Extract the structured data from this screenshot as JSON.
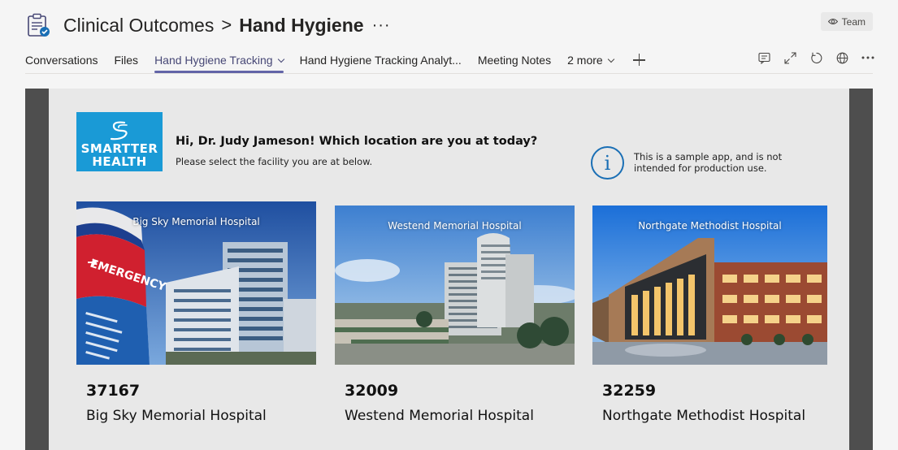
{
  "header": {
    "breadcrumb_parent": "Clinical Outcomes",
    "separator": ">",
    "current_channel": "Hand Hygiene",
    "more_label": "···",
    "team_badge": "Team"
  },
  "tabs": [
    {
      "label": "Conversations",
      "active": false
    },
    {
      "label": "Files",
      "active": false
    },
    {
      "label": "Hand Hygiene Tracking",
      "active": true
    },
    {
      "label": "Hand Hygiene Tracking Analyt...",
      "active": false
    },
    {
      "label": "Meeting Notes",
      "active": false
    },
    {
      "label": "2 more",
      "active": false
    }
  ],
  "toolbar": {
    "icons": [
      "chat-icon",
      "expand-icon",
      "refresh-icon",
      "globe-icon",
      "more-options-icon"
    ]
  },
  "app": {
    "logo_line1": "SMARTTER",
    "logo_line2": "HEALTH",
    "greeting": "Hi, Dr. Judy Jameson! Which location are you at today?",
    "subgreeting": "Please select the facility you are at below.",
    "info_symbol": "i",
    "info_text": "This is a sample app, and is not intended for production use.",
    "hospitals": [
      {
        "photo_label": "Big Sky Memorial Hospital",
        "code": "37167",
        "name": "Big Sky Memorial Hospital"
      },
      {
        "photo_label": "Westend Memorial Hospital",
        "code": "32009",
        "name": "Westend Memorial Hospital"
      },
      {
        "photo_label": "Northgate Methodist Hospital",
        "code": "32259",
        "name": "Northgate Methodist Hospital"
      }
    ],
    "sign_text": "EMERGENCY"
  },
  "colors": {
    "accent": "#6264a7",
    "brand_blue": "#1a9ad6",
    "info_blue": "#1a6fb5",
    "frame_dark": "#4e4e4e"
  }
}
